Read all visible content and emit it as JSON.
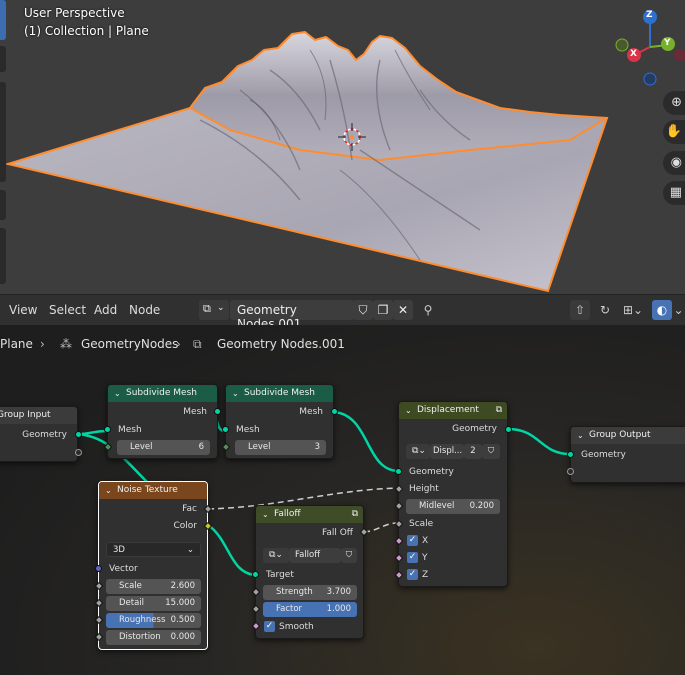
{
  "viewport": {
    "perspective": "User Perspective",
    "collection": "(1) Collection | Plane",
    "gizmo": {
      "z": "Z",
      "y": "Y",
      "x": "X"
    },
    "nav_icons": [
      "zoom-icon",
      "hand-icon",
      "camera-icon",
      "grid-icon"
    ]
  },
  "header": {
    "menu": [
      "View",
      "Select",
      "Add",
      "Node"
    ],
    "nodetree_name": "Geometry Nodes.001"
  },
  "breadcrumb": [
    "Plane",
    "GeometryNodes",
    "Geometry Nodes.001"
  ],
  "nodes": {
    "group_input": {
      "title": "Group Input",
      "out_geometry": "Geometry"
    },
    "subdiv1": {
      "title": "Subdivide Mesh",
      "out_mesh": "Mesh",
      "in_mesh": "Mesh",
      "level_label": "Level",
      "level_value": "6"
    },
    "subdiv2": {
      "title": "Subdivide Mesh",
      "out_mesh": "Mesh",
      "in_mesh": "Mesh",
      "level_label": "Level",
      "level_value": "3"
    },
    "noise": {
      "title": "Noise Texture",
      "out_fac": "Fac",
      "out_color": "Color",
      "dimension": "3D",
      "vector": "Vector",
      "scale_label": "Scale",
      "scale_value": "2.600",
      "detail_label": "Detail",
      "detail_value": "15.000",
      "roughness_label": "Roughness",
      "roughness_value": "0.500",
      "distortion_label": "Distortion",
      "distortion_value": "0.000"
    },
    "falloff": {
      "title": "Falloff",
      "out": "Fall Off",
      "group_name": "Falloff",
      "target": "Target",
      "strength_label": "Strength",
      "strength_value": "3.700",
      "factor_label": "Factor",
      "factor_value": "1.000",
      "smooth": "Smooth"
    },
    "displacement": {
      "title": "Displacement",
      "out_geometry": "Geometry",
      "group_name": "Displ...",
      "users": "2",
      "in_geometry": "Geometry",
      "height": "Height",
      "midlevel_label": "Midlevel",
      "midlevel_value": "0.200",
      "scale": "Scale",
      "x": "X",
      "y": "Y",
      "z": "Z"
    },
    "group_output": {
      "title": "Group Output",
      "in_geometry": "Geometry"
    }
  },
  "colors": {
    "selection_outline": "#ff8c2e",
    "geometry_socket": "#00d6a3",
    "accent_blue": "#4772b3"
  }
}
